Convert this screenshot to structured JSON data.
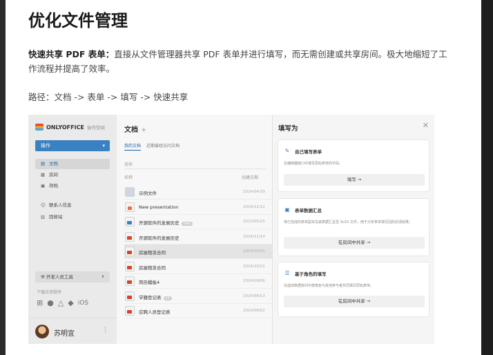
{
  "doc": {
    "title": "优化文件管理",
    "para_strong": "快速共享 PDF 表单：",
    "para_text": "直接从文件管理器共享 PDF 表单并进行填写，而无需创建或共享房间。极大地缩短了工作流程并提高了效率。",
    "path": "路径：文档 -> 表单 -> 填写 -> 快速共享"
  },
  "shot": {
    "logo": "ONLYOFFICE",
    "logo_sub": "协作空间",
    "op_button": "操作",
    "nav": [
      {
        "icon": "document-icon",
        "glyph": "▤",
        "label": "文档"
      },
      {
        "icon": "rooms-icon",
        "glyph": "▦",
        "label": "房间"
      },
      {
        "icon": "archive-icon",
        "glyph": "▣",
        "label": "存档"
      },
      {
        "icon": "contacts-icon",
        "glyph": "☺",
        "label": "联系人信息"
      },
      {
        "icon": "trash-icon",
        "glyph": "▥",
        "label": "回收站"
      }
    ],
    "dev_tools": "开发人员工具",
    "download_apps": "下载应用程序",
    "platform_ios": "iOS",
    "user_name": "苏明宜",
    "main_title": "文档",
    "add_sign": "+",
    "tab_my": "我的文档",
    "tab_recent": "近期曾经访问文档",
    "search_placeholder": "搜索",
    "col_name": "名称",
    "col_date": "创建日期",
    "files": [
      {
        "kind": "folder",
        "name": "示例文件",
        "tag": "",
        "date": "2024/04/29"
      },
      {
        "kind": "slide",
        "name": "New presentation",
        "tag": "",
        "date": "2024/12/12"
      },
      {
        "kind": "form",
        "name": "开源软件的发展历史",
        "tag": "new",
        "date": "2023/05/25"
      },
      {
        "kind": "pdf",
        "name": "开源软件的发展历史",
        "tag": "",
        "date": "2024/11/14"
      },
      {
        "kind": "pdf",
        "name": "房屋租赁合同",
        "tag": "",
        "date": "2024/10/21"
      },
      {
        "kind": "pdf",
        "name": "房屋租赁合同",
        "tag": "",
        "date": "2024/10/21"
      },
      {
        "kind": "pdf",
        "name": "简历模板4",
        "tag": "",
        "date": "2024/09/06"
      },
      {
        "kind": "pdf",
        "name": "学籍登记表",
        "tag": "v2",
        "date": "2024/08/13"
      },
      {
        "kind": "pdf",
        "name": "应聘人员登记表",
        "tag": "",
        "date": "2024/08/02"
      }
    ],
    "panel_title": "填写为",
    "cards": [
      {
        "icon": "pencil-icon",
        "glyph": "✎",
        "title": "自己填写表单",
        "desc": "在编辑器窗口中填写原始表单的字段。",
        "button": "填写 →"
      },
      {
        "icon": "data-summary-icon",
        "glyph": "▣",
        "title": "表单数据汇总",
        "desc": "将已完成的表单副本及其数据汇总至 XLSX 文件，用于分析表单填写回的反馈结果。",
        "button": "在房间中共享 →"
      },
      {
        "icon": "role-list-icon",
        "glyph": "☰",
        "title": "基于角色的填写",
        "desc": "在虚拟数据房间中按角色与其他参与者共同填写原始表单。",
        "button": "在房间中共享 →"
      }
    ]
  }
}
